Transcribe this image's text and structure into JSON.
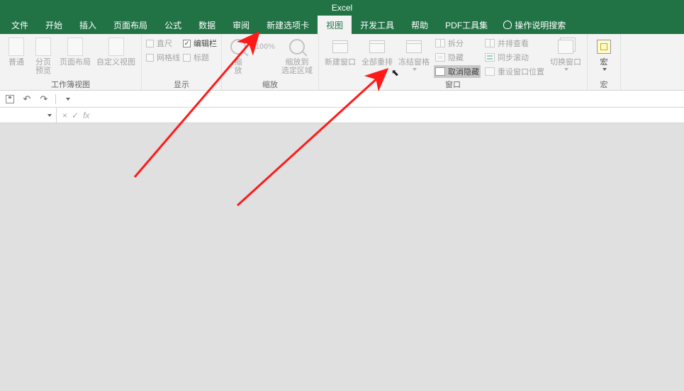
{
  "app": {
    "title": "Excel"
  },
  "tabs": {
    "file": "文件",
    "home": "开始",
    "insert": "插入",
    "pagelayout": "页面布局",
    "formulas": "公式",
    "data": "数据",
    "review": "审阅",
    "newtab": "新建选项卡",
    "view": "视图",
    "developer": "开发工具",
    "help": "帮助",
    "pdf": "PDF工具集",
    "tellme": "操作说明搜索"
  },
  "ribbon": {
    "views": {
      "normal": "普通",
      "pagebreak": "分页\n预览",
      "pagelayout": "页面布局",
      "custom": "自定义视图",
      "group_label": "工作簿视图"
    },
    "show": {
      "ruler": "直尺",
      "formulabar": "编辑栏",
      "gridlines": "网格线",
      "headings": "标题",
      "group_label": "显示",
      "formulabar_checked": "✓"
    },
    "zoom": {
      "zoom": "缩\n放",
      "hundred": "100%",
      "toselection": "缩放到\n选定区域",
      "group_label": "缩放"
    },
    "window": {
      "new": "新建窗口",
      "arrange": "全部重排",
      "freeze": "冻结窗格",
      "split": "拆分",
      "hide": "隐藏",
      "unhide": "取消隐藏",
      "sidebyside": "并排查看",
      "syncscroll": "同步滚动",
      "resetpos": "重设窗口位置",
      "switch": "切换窗口",
      "group_label": "窗口"
    },
    "macros": {
      "macros": "宏",
      "group_label": "宏"
    }
  },
  "formulabar": {
    "fx": "fx",
    "cancel": "×",
    "confirm": "✓"
  }
}
